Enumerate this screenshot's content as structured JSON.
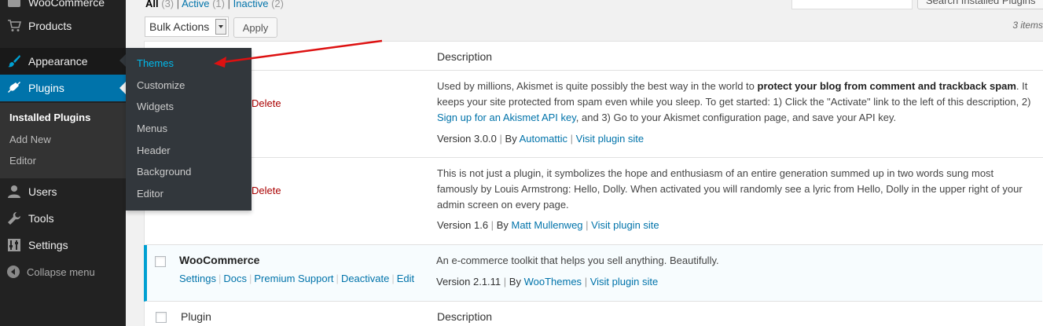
{
  "sidebar": {
    "items": [
      {
        "label": "WooCommerce",
        "icon": "woocommerce-icon"
      },
      {
        "label": "Products",
        "icon": "cart-icon"
      },
      {
        "label": "Appearance",
        "icon": "brush-icon"
      },
      {
        "label": "Plugins",
        "icon": "plugin-icon"
      },
      {
        "label": "Users",
        "icon": "user-icon"
      },
      {
        "label": "Tools",
        "icon": "wrench-icon"
      },
      {
        "label": "Settings",
        "icon": "settings-icon"
      }
    ],
    "plugins_submenu": [
      "Installed Plugins",
      "Add New",
      "Editor"
    ],
    "collapse_label": "Collapse menu"
  },
  "flyout": {
    "items": [
      "Themes",
      "Customize",
      "Widgets",
      "Menus",
      "Header",
      "Background",
      "Editor"
    ]
  },
  "filters": {
    "all_label": "All",
    "all_count": "(3)",
    "active_label": "Active",
    "active_count": "(1)",
    "inactive_label": "Inactive",
    "inactive_count": "(2)",
    "separator": "|"
  },
  "search": {
    "button_label": "Search Installed Plugins"
  },
  "bulk": {
    "select_value": "Bulk Actions",
    "apply_label": "Apply"
  },
  "items_count": "3 items",
  "table": {
    "desc_header": "Description",
    "footer_plugin": "Plugin",
    "footer_desc": "Description",
    "rows": [
      {
        "delete": "Delete",
        "desc_a": "Used by millions, Akismet is quite possibly the best way in the world to ",
        "desc_bold": "protect your blog from comment and trackback spam",
        "desc_b": ". It keeps your site protected from spam even while you sleep. To get started: 1) Click the \"Activate\" link to the left of this description, 2) ",
        "desc_link": "Sign up for an Akismet API key",
        "desc_c": ", and 3) Go to your Akismet configuration page, and save your API key.",
        "version": "Version 3.0.0",
        "by": "By",
        "author": "Automattic",
        "site": "Visit plugin site"
      },
      {
        "delete": "Delete",
        "desc": "This is not just a plugin, it symbolizes the hope and enthusiasm of an entire generation summed up in two words sung most famously by Louis Armstrong: Hello, Dolly. When activated you will randomly see a lyric from Hello, Dolly in the upper right of your admin screen on every page.",
        "version": "Version 1.6",
        "by": "By",
        "author": "Matt Mullenweg",
        "site": "Visit plugin site"
      },
      {
        "title": "WooCommerce",
        "actions": [
          "Settings",
          "Docs",
          "Premium Support",
          "Deactivate",
          "Edit"
        ],
        "desc": "An e-commerce toolkit that helps you sell anything. Beautifully.",
        "version": "Version 2.1.11",
        "by": "By",
        "author": "WooThemes",
        "site": "Visit plugin site"
      }
    ]
  },
  "colors": {
    "sidebar_bg": "#222222",
    "active_blue": "#0073aa",
    "flyout_highlight": "#00b9eb",
    "arrow_red": "#dd1111",
    "delete_red": "#aa0000"
  }
}
